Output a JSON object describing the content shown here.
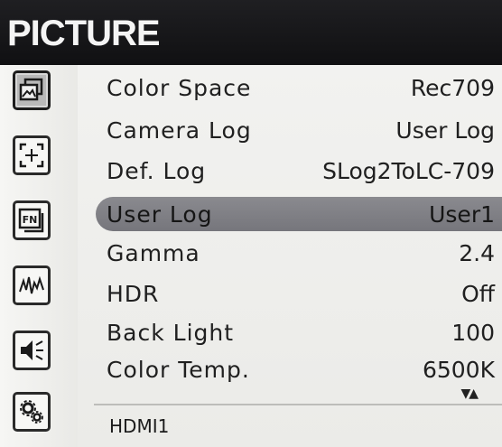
{
  "header": {
    "title": "PICTURE"
  },
  "sidebar": {
    "items": [
      {
        "icon": "picture-icon",
        "active": true
      },
      {
        "icon": "marker-icon",
        "active": false
      },
      {
        "icon": "function-key-icon",
        "active": false
      },
      {
        "icon": "waveform-icon",
        "active": false
      },
      {
        "icon": "audio-icon",
        "active": false
      },
      {
        "icon": "system-settings-icon",
        "active": false
      }
    ]
  },
  "menu": {
    "items": [
      {
        "label": "Color Space",
        "value": "Rec709"
      },
      {
        "label": "Camera Log",
        "value": "User Log"
      },
      {
        "label": "Def. Log",
        "value": "SLog2ToLC-709"
      },
      {
        "label": "User Log",
        "value": "User1",
        "selected": true
      },
      {
        "label": "Gamma",
        "value": "2.4"
      },
      {
        "label": "HDR",
        "value": "Off"
      },
      {
        "label": "Back Light",
        "value": "100"
      },
      {
        "label": "Color Temp.",
        "value": "6500K"
      }
    ],
    "scroll_indicator": "▼▲"
  },
  "footer": {
    "source": "HDMI1"
  },
  "colors": {
    "header_bg": "#151517",
    "selection": "#7f7f84",
    "panel_bg": "#efefec"
  }
}
